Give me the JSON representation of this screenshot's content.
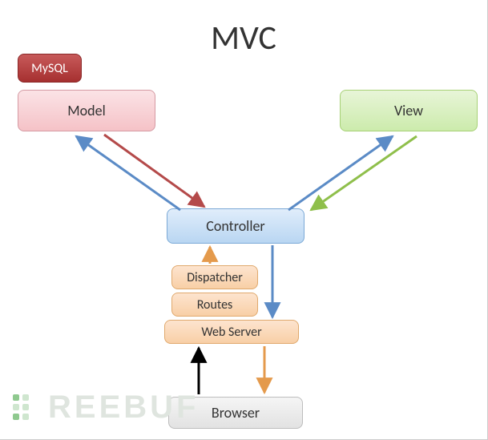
{
  "title": "MVC",
  "boxes": {
    "mysql": "MySQL",
    "model": "Model",
    "view": "View",
    "controller": "Controller",
    "dispatcher": "Dispatcher",
    "routes": "Routes",
    "webserver": "Web Server",
    "browser": "Browser"
  },
  "colors": {
    "blue": "#5b8bc6",
    "red": "#b44a4a",
    "green": "#8fbf4b",
    "orange": "#e49a4c",
    "black": "#000000"
  },
  "watermark": "REEBUF",
  "chart_data": {
    "type": "diagram",
    "title": "MVC",
    "nodes": [
      {
        "id": "mysql",
        "label": "MySQL",
        "color": "dark-red"
      },
      {
        "id": "model",
        "label": "Model",
        "color": "pink"
      },
      {
        "id": "view",
        "label": "View",
        "color": "green"
      },
      {
        "id": "controller",
        "label": "Controller",
        "color": "blue"
      },
      {
        "id": "dispatcher",
        "label": "Dispatcher",
        "color": "orange"
      },
      {
        "id": "routes",
        "label": "Routes",
        "color": "orange"
      },
      {
        "id": "webserver",
        "label": "Web Server",
        "color": "orange"
      },
      {
        "id": "browser",
        "label": "Browser",
        "color": "gray"
      }
    ],
    "edges": [
      {
        "from": "controller",
        "to": "model",
        "color": "blue",
        "direction": "to"
      },
      {
        "from": "model",
        "to": "controller",
        "color": "red",
        "direction": "to"
      },
      {
        "from": "controller",
        "to": "view",
        "color": "blue",
        "direction": "to"
      },
      {
        "from": "view",
        "to": "controller",
        "color": "green",
        "direction": "to"
      },
      {
        "from": "dispatcher",
        "to": "controller",
        "color": "orange",
        "direction": "to"
      },
      {
        "from": "controller",
        "to": "webserver",
        "color": "blue",
        "direction": "to"
      },
      {
        "from": "browser",
        "to": "webserver",
        "color": "black",
        "direction": "to"
      },
      {
        "from": "webserver",
        "to": "browser",
        "color": "orange",
        "direction": "to"
      }
    ],
    "stack": [
      "dispatcher",
      "routes",
      "webserver"
    ],
    "attached": [
      {
        "node": "mysql",
        "to": "model"
      }
    ]
  }
}
